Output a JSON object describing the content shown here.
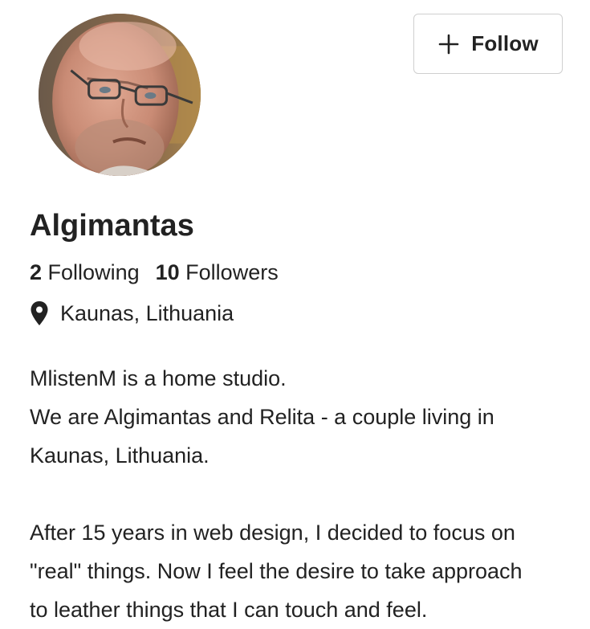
{
  "profile": {
    "name": "Algimantas",
    "avatar_alt": "profile photo"
  },
  "follow_button": {
    "icon": "plus-icon",
    "label": "Follow"
  },
  "stats": {
    "following_count": "2",
    "following_label": "Following",
    "followers_count": "10",
    "followers_label": "Followers"
  },
  "location": {
    "icon": "map-pin-icon",
    "text": "Kaunas, Lithuania"
  },
  "bio": {
    "lines": [
      "MlistenM is a home studio.",
      "We are Algimantas and Relita - a couple living in",
      "Kaunas, Lithuania.",
      "",
      "After 15 years in web design, I decided to focus on",
      "\"real\" things. Now I feel the desire to take approach",
      "to leather things that I can touch and feel."
    ]
  },
  "colors": {
    "text": "#222222",
    "button_border": "#cfcfcf",
    "background": "#ffffff"
  }
}
